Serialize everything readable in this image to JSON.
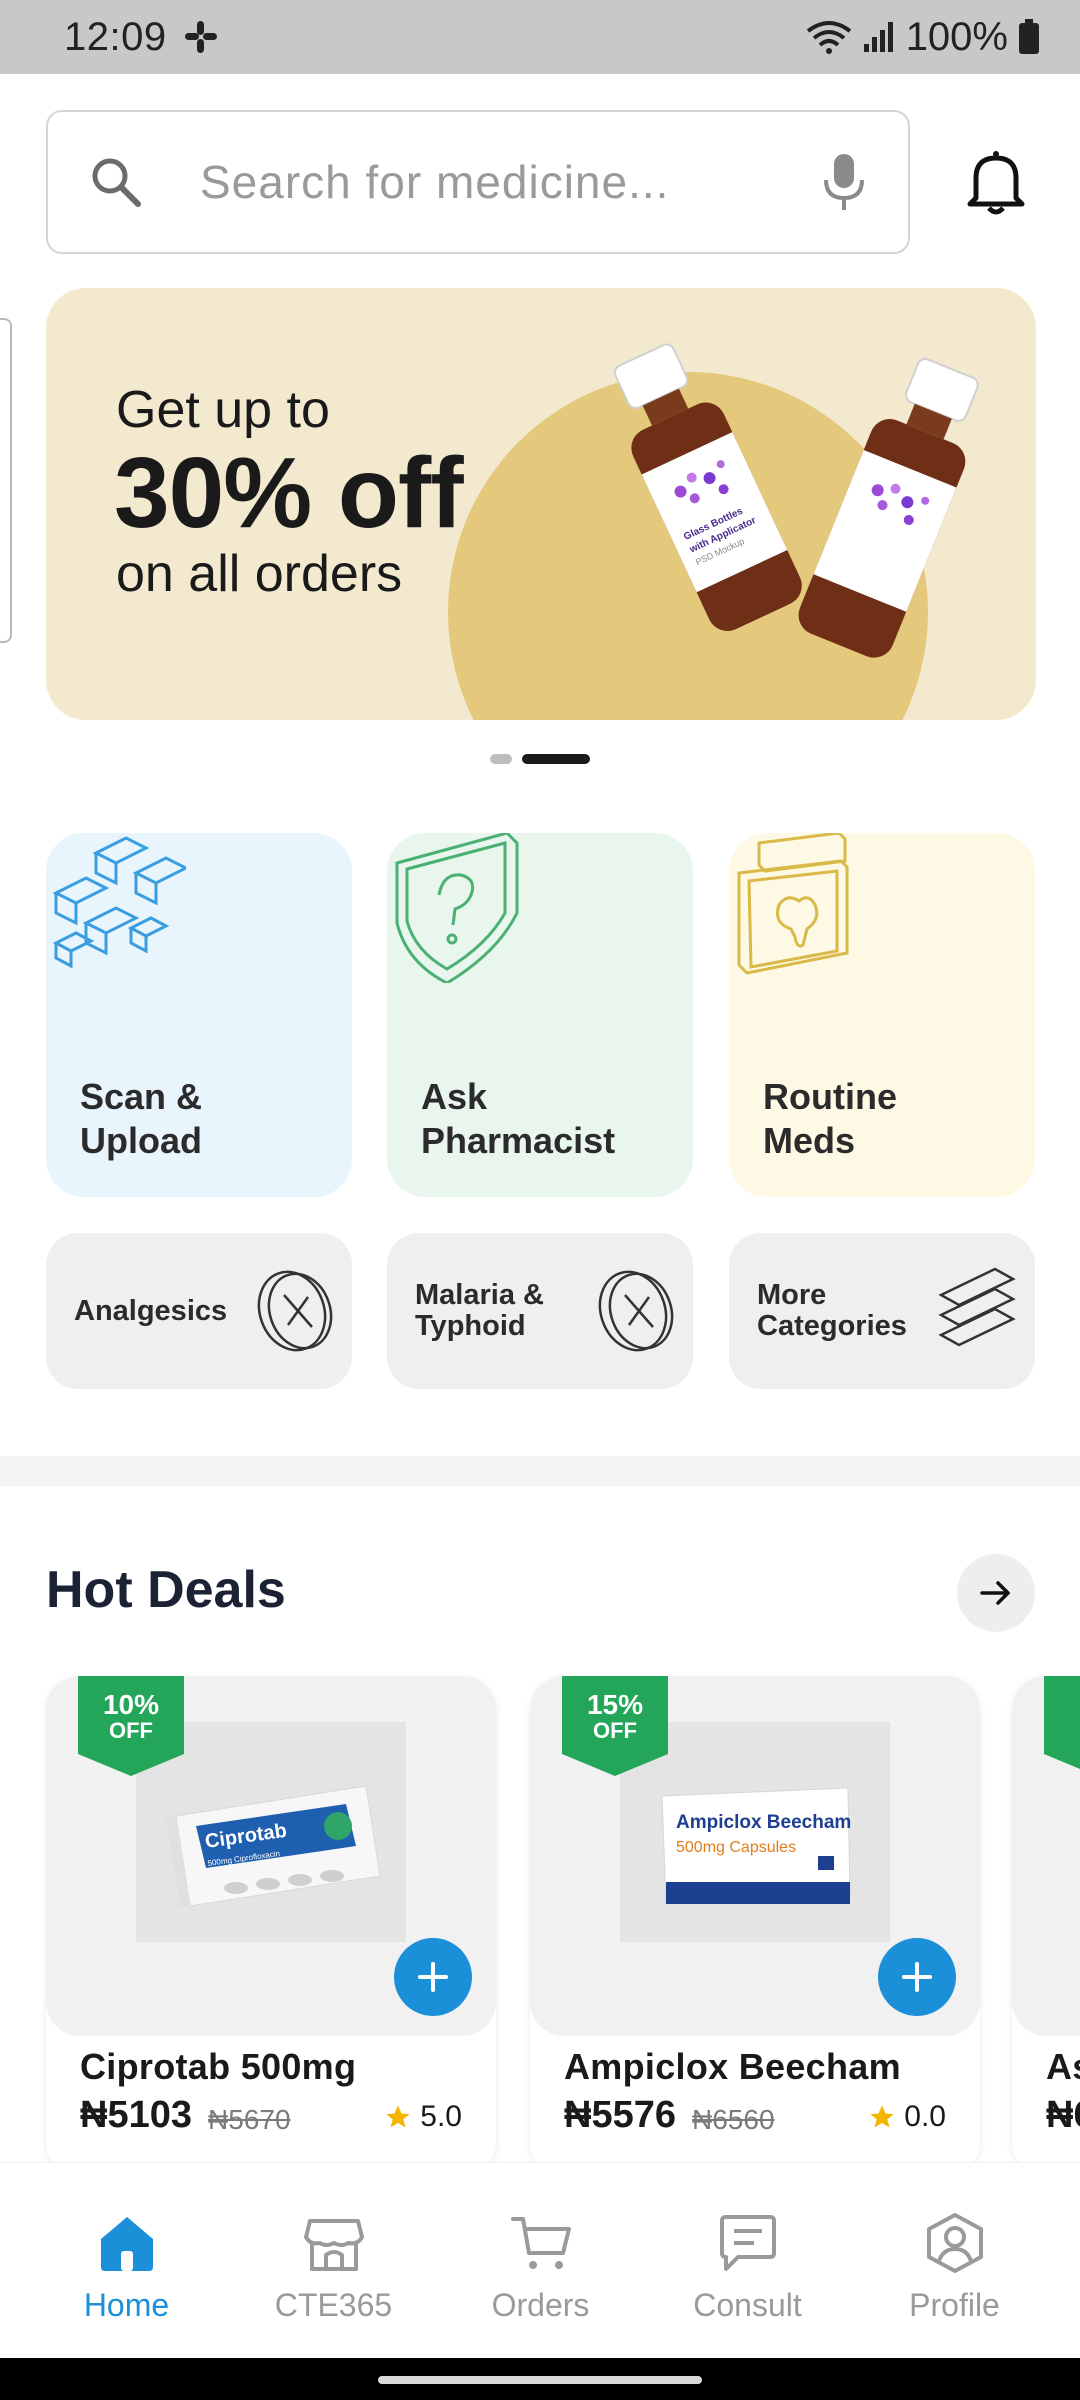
{
  "status_bar": {
    "time": "12:09",
    "battery": "100%"
  },
  "search": {
    "placeholder": "Search for medicine..."
  },
  "banner": {
    "line1": "Get up to",
    "line2": "30% off",
    "line3": "on all orders",
    "bottle_label_line1": "Glass Bottles",
    "bottle_label_line2": "with Applicator",
    "bottle_label_line3": "PSD Mockup"
  },
  "features": [
    {
      "label_line1": "Scan &",
      "label_line2": "Upload",
      "icon": "qr-code-icon"
    },
    {
      "label_line1": "Ask",
      "label_line2": "Pharmacist",
      "icon": "question-shield-icon"
    },
    {
      "label_line1": "Routine",
      "label_line2": "Meds",
      "icon": "pill-bottle-icon"
    }
  ],
  "categories": [
    {
      "label_line1": "Analgesics",
      "label_line2": "",
      "icon": "pill-icon"
    },
    {
      "label_line1": "Malaria &",
      "label_line2": "Typhoid",
      "icon": "pill-icon"
    },
    {
      "label_line1": "More",
      "label_line2": "Categories",
      "icon": "stack-icon"
    }
  ],
  "hot_deals": {
    "title": "Hot Deals",
    "items": [
      {
        "discount": "10%",
        "off": "OFF",
        "name": "Ciprotab 500mg",
        "price": "₦5103",
        "old_price": "₦5670",
        "rating": "5.0",
        "box_brand": "Ciprotab",
        "box_sub": "500mg Ciprofloxacin"
      },
      {
        "discount": "15%",
        "off": "OFF",
        "name": "Ampiclox Beecham",
        "price": "₦5576",
        "old_price": "₦6560",
        "rating": "0.0",
        "box_brand": "Ampiclox Beecham",
        "box_sub": "500mg Capsules"
      },
      {
        "discount": "1",
        "off": "",
        "name": "As",
        "price": "₦6",
        "old_price": "",
        "rating": ""
      }
    ]
  },
  "nav": {
    "items": [
      {
        "label": "Home",
        "icon": "home-icon"
      },
      {
        "label": "CTE365",
        "icon": "store-icon"
      },
      {
        "label": "Orders",
        "icon": "cart-icon"
      },
      {
        "label": "Consult",
        "icon": "chat-icon"
      },
      {
        "label": "Profile",
        "icon": "profile-icon"
      }
    ]
  },
  "colors": {
    "accent": "#1c8fd9",
    "badge_green": "#23a65a",
    "banner_bg": "#f3e9cf",
    "banner_circle": "#e4c87b"
  }
}
